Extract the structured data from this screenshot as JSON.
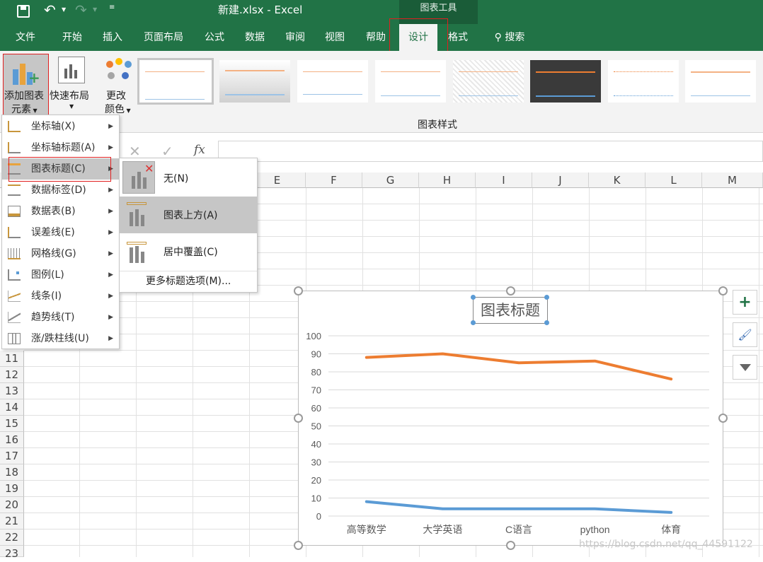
{
  "titlebar": {
    "filename": "新建.xlsx",
    "separator": "-",
    "app": "Excel",
    "context_tab_group": "图表工具"
  },
  "tabs": [
    "文件",
    "开始",
    "插入",
    "页面布局",
    "公式",
    "数据",
    "审阅",
    "视图",
    "帮助",
    "设计",
    "格式"
  ],
  "search_label": "搜索",
  "ribbon": {
    "add_element": [
      "添加图表",
      "元素"
    ],
    "quick_layout": "快速布局",
    "change_color": [
      "更改",
      "颜色"
    ],
    "group_label": "图表样式"
  },
  "add_element_menu": [
    {
      "label": "坐标轴(X)"
    },
    {
      "label": "坐标轴标题(A)"
    },
    {
      "label": "图表标题(C)"
    },
    {
      "label": "数据标签(D)"
    },
    {
      "label": "数据表(B)"
    },
    {
      "label": "误差线(E)"
    },
    {
      "label": "网格线(G)"
    },
    {
      "label": "图例(L)"
    },
    {
      "label": "线条(I)"
    },
    {
      "label": "趋势线(T)"
    },
    {
      "label": "涨/跌柱线(U)"
    }
  ],
  "title_submenu": {
    "items": [
      "无(N)",
      "图表上方(A)",
      "居中覆盖(C)"
    ],
    "more": "更多标题选项(M)..."
  },
  "columns": [
    "E",
    "F",
    "G",
    "H",
    "I",
    "J",
    "K",
    "L",
    "M"
  ],
  "rows": [
    "11",
    "12",
    "13",
    "14",
    "15",
    "16",
    "17",
    "18",
    "19",
    "20",
    "21",
    "22",
    "23"
  ],
  "colors": {
    "excel_green": "#217346",
    "orange": "#ED7D31",
    "blue": "#5B9BD5"
  },
  "watermark": "https://blog.csdn.net/qq_44591122",
  "chart_data": {
    "type": "line",
    "title": "图表标题",
    "categories": [
      "高等数学",
      "大学英语",
      "C语言",
      "python",
      "体育"
    ],
    "series": [
      {
        "values": [
          88,
          90,
          85,
          86,
          76
        ]
      },
      {
        "values": [
          8,
          4,
          4,
          4,
          2
        ]
      }
    ],
    "ylim": [
      0,
      100
    ],
    "yticks": [
      "0",
      "10",
      "20",
      "30",
      "40",
      "50",
      "60",
      "70",
      "80",
      "90",
      "100"
    ],
    "grid": true
  }
}
